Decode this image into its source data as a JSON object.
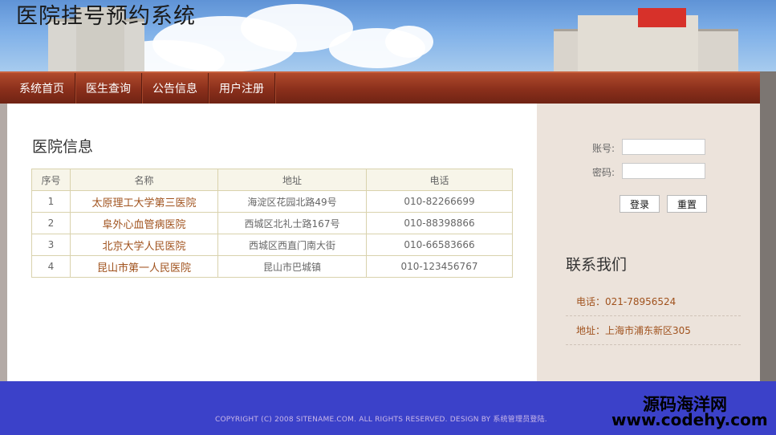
{
  "header": {
    "title": "医院挂号预约系统"
  },
  "nav": {
    "items": [
      {
        "label": "系统首页"
      },
      {
        "label": "医生查询"
      },
      {
        "label": "公告信息"
      },
      {
        "label": "用户注册"
      }
    ]
  },
  "main": {
    "heading": "医院信息",
    "columns": [
      "序号",
      "名称",
      "地址",
      "电话"
    ],
    "rows": [
      {
        "no": "1",
        "name": "太原理工大学第三医院",
        "address": "海淀区花园北路49号",
        "phone": "010-82266699"
      },
      {
        "no": "2",
        "name": "阜外心血管病医院",
        "address": "西城区北礼士路167号",
        "phone": "010-88398866"
      },
      {
        "no": "3",
        "name": "北京大学人民医院",
        "address": "西城区西直门南大街",
        "phone": "010-66583666"
      },
      {
        "no": "4",
        "name": "昆山市第一人民医院",
        "address": "昆山市巴城镇",
        "phone": "010-123456767"
      }
    ]
  },
  "login": {
    "account_label": "账号:",
    "password_label": "密码:",
    "account_value": "",
    "password_value": "",
    "login_button": "登录",
    "reset_button": "重置"
  },
  "contact": {
    "title": "联系我们",
    "phone": "电话：021-78956524",
    "address": "地址：上海市浦东新区305"
  },
  "footer": {
    "copyright": "COPYRIGHT (C) 2008 SITENAME.COM. ALL RIGHTS RESERVED. DESIGN BY 系统管理员登陆."
  },
  "watermark": {
    "line1": "源码海洋网",
    "line2": "www.codehy.com"
  },
  "colors": {
    "nav": "#8a2f1b",
    "footer": "#3b41c9",
    "sidebar": "#ece3db",
    "link": "#a0521d"
  }
}
